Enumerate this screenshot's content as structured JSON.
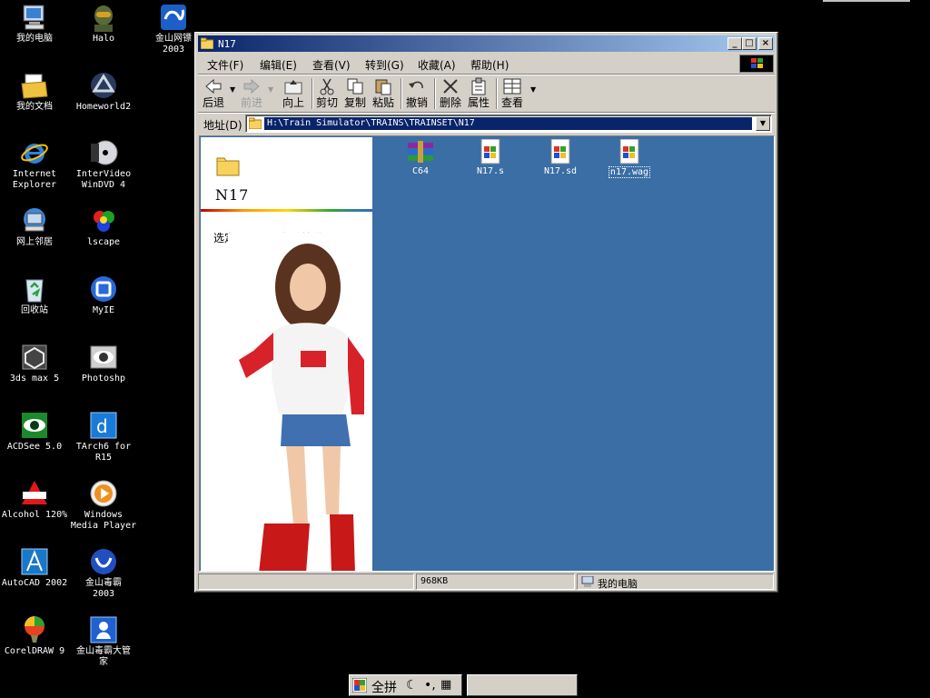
{
  "desktop": {
    "icons": [
      {
        "name": "my-computer",
        "label": "我的电脑",
        "icon": "computer-icon"
      },
      {
        "name": "halo",
        "label": "Halo",
        "icon": "halo-icon"
      },
      {
        "name": "kingsoft-web",
        "label": "金山网镖\n2003",
        "icon": "kingsoft-shield-icon"
      },
      {
        "name": "my-documents",
        "label": "我的文档",
        "icon": "documents-folder-icon"
      },
      {
        "name": "homeworld2",
        "label": "Homeworld2",
        "icon": "homeworld-icon"
      },
      {
        "name": "internet-explorer",
        "label": "Internet\nExplorer",
        "icon": "ie-icon"
      },
      {
        "name": "intervideo",
        "label": "InterVideo\nWinDVD 4",
        "icon": "dvd-icon"
      },
      {
        "name": "network",
        "label": "网上邻居",
        "icon": "network-icon"
      },
      {
        "name": "lscape",
        "label": "lscape",
        "icon": "lscape-icon"
      },
      {
        "name": "recycle-bin",
        "label": "回收站",
        "icon": "recycle-bin-icon"
      },
      {
        "name": "myie",
        "label": "MyIE",
        "icon": "myie-icon"
      },
      {
        "name": "3dsmax",
        "label": "3ds max 5",
        "icon": "3dsmax-icon"
      },
      {
        "name": "photoshop",
        "label": "Photoshp",
        "icon": "photoshop-icon"
      },
      {
        "name": "acdsee",
        "label": "ACDSee 5.0",
        "icon": "acdsee-icon"
      },
      {
        "name": "tarch",
        "label": "TArch6 for\nR15",
        "icon": "tarch-icon"
      },
      {
        "name": "alcohol",
        "label": "Alcohol 120%",
        "icon": "alcohol-icon"
      },
      {
        "name": "wmp",
        "label": "Windows\nMedia Player",
        "icon": "media-player-icon"
      },
      {
        "name": "autocad",
        "label": "AutoCAD 2002",
        "icon": "autocad-icon"
      },
      {
        "name": "kingsoft-av",
        "label": "金山毒霸\n2003",
        "icon": "kingsoft-av-icon"
      },
      {
        "name": "coreldraw",
        "label": "CorelDRAW 9",
        "icon": "coreldraw-icon"
      },
      {
        "name": "kingsoft-mgr",
        "label": "金山毒霸大管\n家",
        "icon": "kingsoft-manager-icon"
      }
    ]
  },
  "window": {
    "title": "N17",
    "menu": [
      "文件(F)",
      "编辑(E)",
      "查看(V)",
      "转到(G)",
      "收藏(A)",
      "帮助(H)"
    ],
    "toolbar": {
      "back": "后退",
      "forward": "前进",
      "up": "向上",
      "cut": "剪切",
      "copy": "复制",
      "paste": "粘贴",
      "undo": "撤销",
      "delete": "删除",
      "properties": "属性",
      "views": "查看"
    },
    "address": {
      "label": "地址(D)",
      "value": "H:\\Train Simulator\\TRAINS\\TRAINSET\\N17"
    },
    "left_pane": {
      "folder_title": "N17",
      "description": "选定项目可以查看其说明。"
    },
    "files": [
      {
        "label": "C64",
        "icon": "rar-archive-icon",
        "selected": false
      },
      {
        "label": "N17.s",
        "icon": "windows-file-icon",
        "selected": false
      },
      {
        "label": "N17.sd",
        "icon": "windows-file-icon",
        "selected": false
      },
      {
        "label": "n17.wag",
        "icon": "windows-file-icon",
        "selected": true
      }
    ],
    "status": {
      "left": "",
      "size": "968KB",
      "location": "我的电脑"
    }
  },
  "taskbar": {
    "ime_text": "全拼"
  },
  "colors": {
    "desktop": "#000000",
    "content_bg": "#3a6ea5",
    "titlebar_start": "#0a246a",
    "titlebar_end": "#a6caf0",
    "face": "#d4d0c8"
  }
}
